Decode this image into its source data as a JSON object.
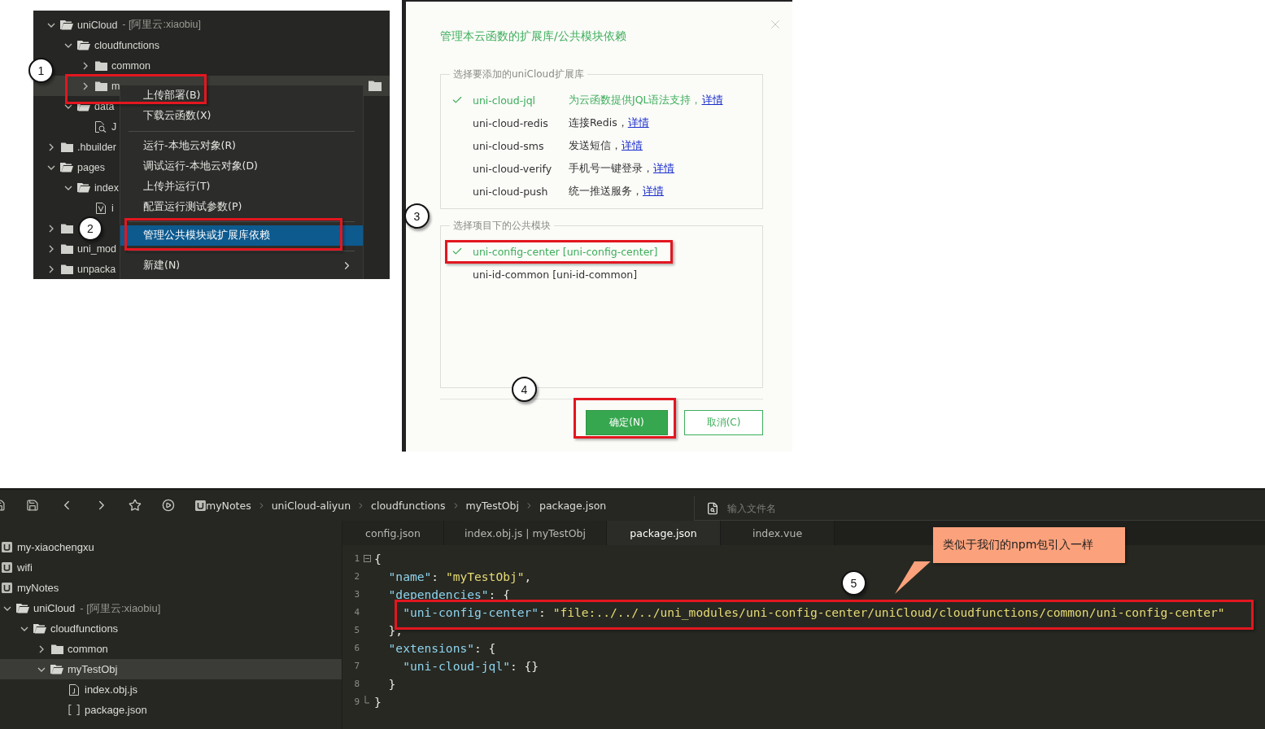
{
  "explorer_panel": {
    "tree": [
      {
        "kind": "folder",
        "label": "uniCloud",
        "note": "- [阿里云:xiaobiu]",
        "expanded": true,
        "selected": false,
        "children": [
          {
            "kind": "folder",
            "label": "cloudfunctions",
            "expanded": true,
            "selected": false,
            "children": [
              {
                "kind": "folder",
                "label": "common",
                "expanded": false,
                "selected": false
              },
              {
                "kind": "folder",
                "label": "m",
                "expanded": false,
                "selected": true
              }
            ]
          },
          {
            "kind": "folder",
            "label": "data",
            "expanded": true,
            "selected": false,
            "children": [
              {
                "kind": "schema-file",
                "label": "J",
                "selected": false
              }
            ]
          }
        ]
      },
      {
        "kind": "folder",
        "label": ".hbuilder",
        "expanded": false,
        "selected": false
      },
      {
        "kind": "folder",
        "label": "pages",
        "expanded": true,
        "selected": false,
        "children": [
          {
            "kind": "folder",
            "label": "index",
            "expanded": true,
            "selected": false,
            "children": [
              {
                "kind": "vue-file",
                "label": "i",
                "selected": false
              }
            ]
          }
        ]
      },
      {
        "kind": "folder",
        "expanded": false,
        "selected": false
      },
      {
        "kind": "folder",
        "label": "uni_mod",
        "expanded": false,
        "selected": false
      },
      {
        "kind": "folder",
        "label": "unpacka",
        "expanded": false,
        "selected": false
      }
    ],
    "context_menu": [
      {
        "kind": "item",
        "label": "上传部署(B)",
        "selected": false
      },
      {
        "kind": "item",
        "label": "下载云函数(X)",
        "selected": false
      },
      {
        "kind": "separator"
      },
      {
        "kind": "item",
        "label": "运行-本地云对象(R)",
        "selected": false
      },
      {
        "kind": "item",
        "label": "调试运行-本地云对象(D)",
        "selected": false
      },
      {
        "kind": "item",
        "label": "上传并运行(T)",
        "selected": false
      },
      {
        "kind": "item",
        "label": "配置运行测试参数(P)",
        "selected": false
      },
      {
        "kind": "separator"
      },
      {
        "kind": "item",
        "label": "管理公共模块或扩展库依赖",
        "selected": true
      },
      {
        "kind": "separator"
      },
      {
        "kind": "submenu",
        "label": "新建(N)",
        "selected": false
      }
    ],
    "markers": [
      "1",
      "2"
    ]
  },
  "dialog": {
    "title": "管理本云函数的扩展库/公共模块依赖",
    "extensions": {
      "legend": "选择要添加的uniCloud扩展库",
      "items": [
        {
          "name": "uni-cloud-jql",
          "description": "为云函数提供JQL语法支持，",
          "link": "详情",
          "checked": true
        },
        {
          "name": "uni-cloud-redis",
          "description": "连接Redis，",
          "link": "详情",
          "checked": false
        },
        {
          "name": "uni-cloud-sms",
          "description": "发送短信，",
          "link": "详情",
          "checked": false
        },
        {
          "name": "uni-cloud-verify",
          "description": "手机号一键登录，",
          "link": "详情",
          "checked": false
        },
        {
          "name": "uni-cloud-push",
          "description": "统一推送服务，",
          "link": "详情",
          "checked": false
        }
      ]
    },
    "modules": {
      "legend": "选择项目下的公共模块",
      "items": [
        {
          "name": "uni-config-center [uni-config-center]",
          "checked": true
        },
        {
          "name": "uni-id-common [uni-id-common]",
          "checked": false
        }
      ]
    },
    "buttons": [
      {
        "label": "确定(N)",
        "kind": "primary"
      },
      {
        "label": "取消(C)",
        "kind": "secondary"
      }
    ],
    "markers": [
      "3",
      "4"
    ]
  },
  "editor_window": {
    "breadcrumb": [
      "myNotes",
      "uniCloud-aliyun",
      "cloudfunctions",
      "myTestObj",
      "package.json"
    ],
    "search": {
      "placeholder": "输入文件名"
    },
    "tree": [
      {
        "kind": "project",
        "label": "my-xiaochengxu",
        "selected": false
      },
      {
        "kind": "project",
        "label": "wifi",
        "selected": false
      },
      {
        "kind": "project",
        "label": "myNotes",
        "selected": false,
        "children": [
          {
            "kind": "folder",
            "label": "uniCloud",
            "note": "- [阿里云:xiaobiu]",
            "expanded": true,
            "selected": false,
            "children": [
              {
                "kind": "folder",
                "label": "cloudfunctions",
                "expanded": true,
                "selected": false,
                "children": [
                  {
                    "kind": "folder",
                    "label": "common",
                    "expanded": false,
                    "selected": false
                  },
                  {
                    "kind": "folder",
                    "label": "myTestObj",
                    "expanded": true,
                    "selected": true,
                    "children": [
                      {
                        "kind": "js-file",
                        "label": "index.obj.js",
                        "selected": false
                      },
                      {
                        "kind": "json-file",
                        "label": "package.json",
                        "selected": false
                      }
                    ]
                  }
                ]
              }
            ]
          }
        ]
      }
    ],
    "tabs": [
      {
        "label": "config.json",
        "selected": false
      },
      {
        "label": "index.obj.js | myTestObj",
        "selected": false
      },
      {
        "label": "package.json",
        "selected": true
      },
      {
        "label": "index.vue",
        "selected": false
      }
    ],
    "code": [
      {
        "number": "1",
        "kind": "fold-start",
        "tokens": [
          {
            "kind": "punct",
            "text": "{"
          }
        ]
      },
      {
        "number": "2",
        "kind": "plain",
        "tokens": [
          {
            "kind": "key",
            "text": "  \"name\""
          },
          {
            "kind": "punct",
            "text": ": "
          },
          {
            "kind": "string",
            "text": "\"myTestObj\""
          },
          {
            "kind": "punct",
            "text": ","
          }
        ]
      },
      {
        "number": "3",
        "kind": "plain",
        "tokens": [
          {
            "kind": "key",
            "text": "  \"dependencies\""
          },
          {
            "kind": "punct",
            "text": ": {"
          }
        ]
      },
      {
        "number": "4",
        "kind": "plain",
        "tokens": [
          {
            "kind": "key",
            "text": "    \"uni-config-center\""
          },
          {
            "kind": "punct",
            "text": ": "
          },
          {
            "kind": "string",
            "text": "\"file:../../../uni_modules/uni-config-center/uniCloud/cloudfunctions/common/uni-config-center\""
          }
        ]
      },
      {
        "number": "5",
        "kind": "plain",
        "tokens": [
          {
            "kind": "punct",
            "text": "  },"
          }
        ]
      },
      {
        "number": "6",
        "kind": "plain",
        "tokens": [
          {
            "kind": "key",
            "text": "  \"extensions\""
          },
          {
            "kind": "punct",
            "text": ": {"
          }
        ]
      },
      {
        "number": "7",
        "kind": "plain",
        "tokens": [
          {
            "kind": "key",
            "text": "    \"uni-cloud-jql\""
          },
          {
            "kind": "punct",
            "text": ": {}"
          }
        ]
      },
      {
        "number": "8",
        "kind": "plain",
        "tokens": [
          {
            "kind": "punct",
            "text": "  }"
          }
        ]
      },
      {
        "number": "9",
        "kind": "fold-end",
        "tokens": [
          {
            "kind": "punct",
            "text": "}"
          }
        ]
      }
    ],
    "callout": "类似于我们的npm包引入一样",
    "markers": [
      "5"
    ]
  }
}
